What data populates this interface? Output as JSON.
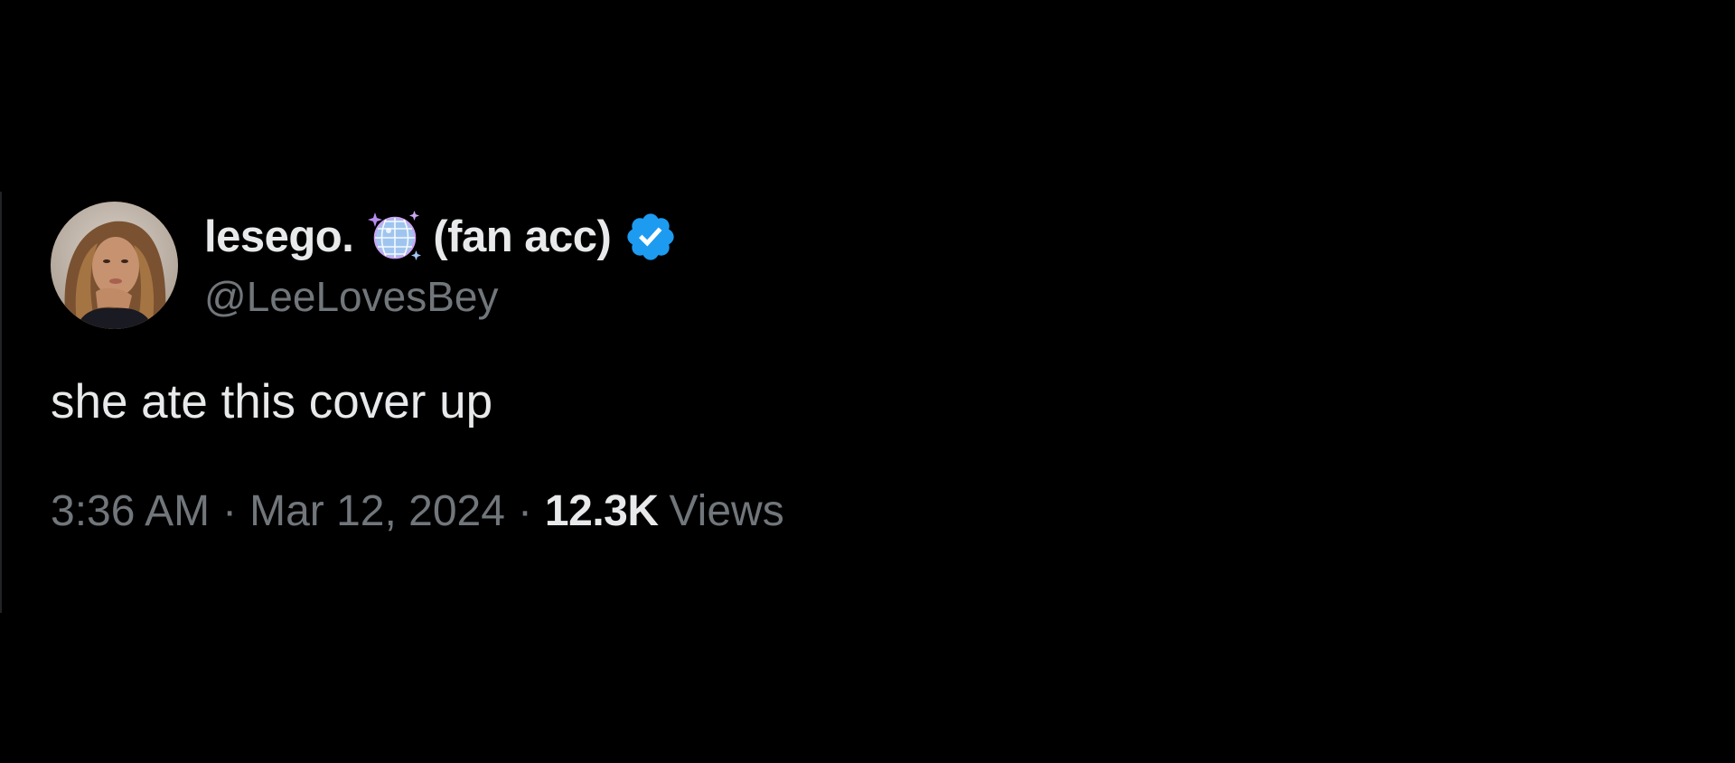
{
  "tweet": {
    "author": {
      "display_name": "lesego.",
      "display_name_suffix": "(fan acc)",
      "emoji_icon": "disco-ball-icon",
      "verified": true,
      "verified_icon": "verified-badge-icon",
      "handle": "@LeeLovesBey"
    },
    "text": "she ate this cover up",
    "meta": {
      "time": "3:36 AM",
      "separator": "·",
      "date": "Mar 12, 2024",
      "views_count": "12.3K",
      "views_label": "Views"
    }
  },
  "colors": {
    "background": "#000000",
    "primary_text": "#e7e9ea",
    "secondary_text": "#71767b",
    "verified_blue": "#1d9bf0"
  }
}
